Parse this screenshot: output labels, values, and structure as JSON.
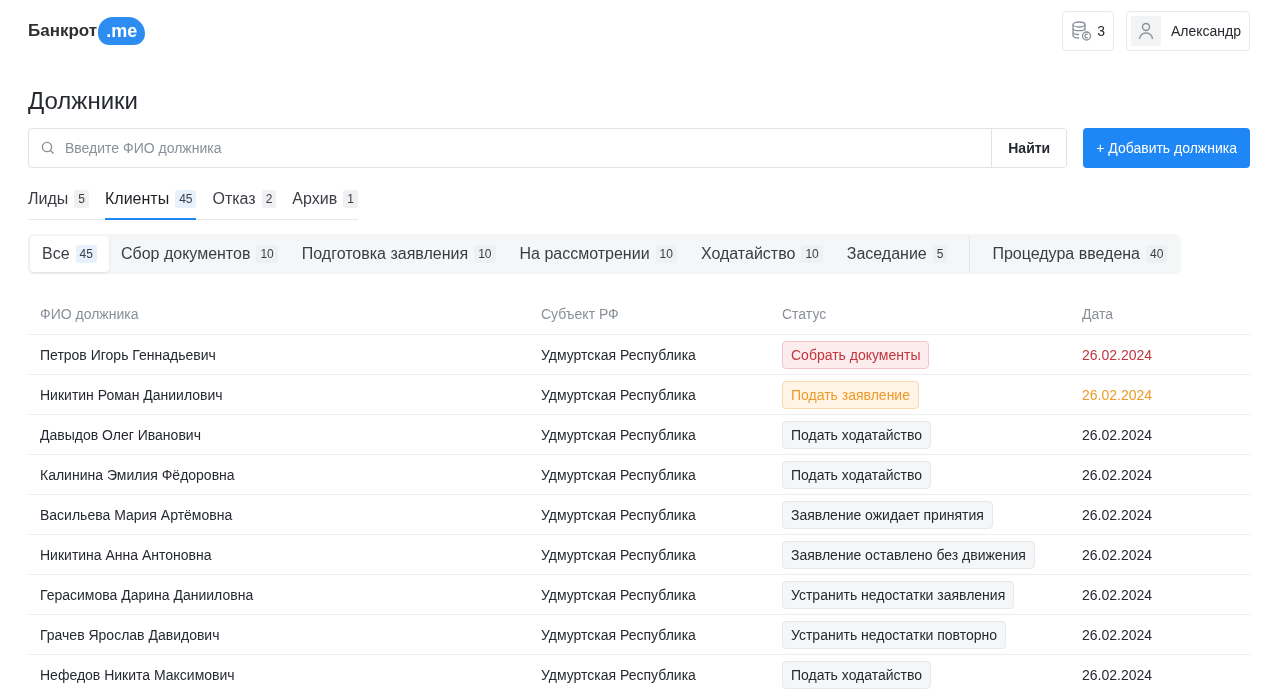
{
  "header": {
    "logo": {
      "word": "Банкрот",
      "badge": ".me"
    },
    "credits": "3",
    "user": "Александр"
  },
  "page_title": "Должники",
  "search": {
    "placeholder": "Введите ФИО должника",
    "button": "Найти"
  },
  "add_button": "+ Добавить должника",
  "tabs": [
    {
      "label": "Лиды",
      "count": "5",
      "selected": false
    },
    {
      "label": "Клиенты",
      "count": "45",
      "selected": true
    },
    {
      "label": "Отказ",
      "count": "2",
      "selected": false
    },
    {
      "label": "Архив",
      "count": "1",
      "selected": false
    }
  ],
  "sub_tab_groups": [
    [
      {
        "label": "Все",
        "count": "45",
        "selected": true
      },
      {
        "label": "Сбор документов",
        "count": "10",
        "selected": false
      },
      {
        "label": "Подготовка заявления",
        "count": "10",
        "selected": false
      },
      {
        "label": "На рассмотрении",
        "count": "10",
        "selected": false
      },
      {
        "label": "Ходатайство",
        "count": "10",
        "selected": false
      },
      {
        "label": "Заседание",
        "count": "5",
        "selected": false
      }
    ],
    [
      {
        "label": "Процедура введена",
        "count": "40",
        "selected": false
      }
    ]
  ],
  "table": {
    "columns": [
      "ФИО должника",
      "Субъект РФ",
      "Статус",
      "Дата"
    ],
    "rows": [
      {
        "name": "Петров Игорь Геннадьевич",
        "region": "Удмуртская Республика",
        "status": "Собрать документы",
        "date": "26.02.2024",
        "kind": "danger"
      },
      {
        "name": "Никитин Роман Даниилович",
        "region": "Удмуртская Республика",
        "status": "Подать заявление",
        "date": "26.02.2024",
        "kind": "warning"
      },
      {
        "name": "Давыдов Олег Иванович",
        "region": "Удмуртская Республика",
        "status": "Подать ходатайство",
        "date": "26.02.2024",
        "kind": "neutral"
      },
      {
        "name": "Калинина Эмилия Фёдоровна",
        "region": "Удмуртская Республика",
        "status": "Подать ходатайство",
        "date": "26.02.2024",
        "kind": "neutral"
      },
      {
        "name": "Васильева Мария Артёмовна",
        "region": "Удмуртская Республика",
        "status": "Заявление ожидает принятия",
        "date": "26.02.2024",
        "kind": "neutral"
      },
      {
        "name": "Никитина Анна Антоновна",
        "region": "Удмуртская Республика",
        "status": "Заявление оставлено без движения",
        "date": "26.02.2024",
        "kind": "neutral"
      },
      {
        "name": "Герасимова Дарина Данииловна",
        "region": "Удмуртская Республика",
        "status": "Устранить недостатки заявления",
        "date": "26.02.2024",
        "kind": "neutral"
      },
      {
        "name": "Грачев Ярослав Давидович",
        "region": "Удмуртская Республика",
        "status": "Устранить недостатки повторно",
        "date": "26.02.2024",
        "kind": "neutral"
      },
      {
        "name": "Нефедов Никита Максимович",
        "region": "Удмуртская Республика",
        "status": "Подать ходатайство",
        "date": "26.02.2024",
        "kind": "neutral"
      }
    ]
  }
}
